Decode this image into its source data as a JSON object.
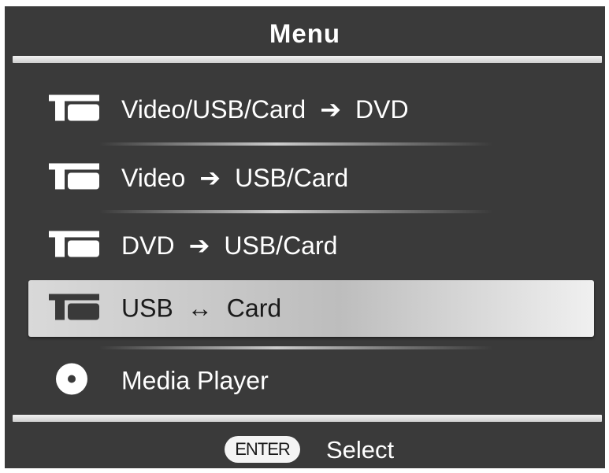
{
  "menu": {
    "title": "Menu",
    "items": [
      {
        "icon": "transfer-icon",
        "source": "Video/USB/Card",
        "arrow": "➔",
        "target": "DVD",
        "selected": false
      },
      {
        "icon": "transfer-icon",
        "source": "Video",
        "arrow": "➔",
        "target": "USB/Card",
        "selected": false
      },
      {
        "icon": "transfer-icon",
        "source": "DVD",
        "arrow": "➔",
        "target": "USB/Card",
        "selected": false
      },
      {
        "icon": "transfer-icon",
        "source": "USB",
        "arrow": "↔",
        "target": "Card",
        "selected": true
      },
      {
        "icon": "disc-icon",
        "label": "Media Player",
        "selected": false
      }
    ]
  },
  "footer": {
    "key_label": "ENTER",
    "action_label": "Select"
  },
  "colors": {
    "background": "#3a3a3a",
    "text": "#ffffff",
    "selected_text": "#1a1a1a",
    "highlight": "#cfcfcf"
  }
}
